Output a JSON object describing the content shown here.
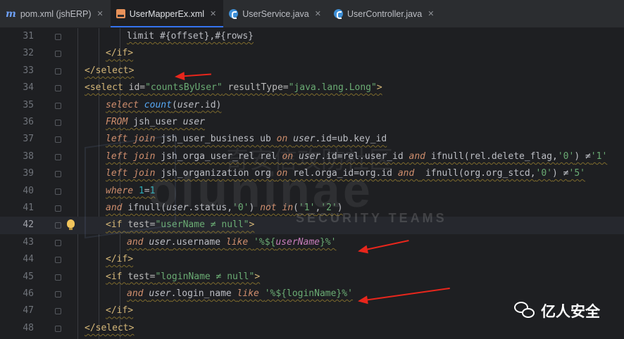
{
  "tabs": [
    {
      "label": "pom.xml (jshERP)",
      "icon": "maven-icon",
      "active": false
    },
    {
      "label": "UserMapperEx.xml",
      "icon": "xml-file-icon",
      "active": true
    },
    {
      "label": "UserService.java",
      "icon": "java-class-icon",
      "active": false
    },
    {
      "label": "UserController.java",
      "icon": "java-class-icon",
      "active": false
    }
  ],
  "editor": {
    "current_line": "42",
    "lines": [
      {
        "n": "31",
        "indent": 3,
        "tokens": [
          [
            "p",
            "limit #{offset},#{rows}"
          ]
        ]
      },
      {
        "n": "32",
        "indent": 2,
        "tokens": [
          [
            "t",
            "</if>"
          ]
        ]
      },
      {
        "n": "33",
        "indent": 1,
        "tokens": [
          [
            "t",
            "</select>"
          ]
        ]
      },
      {
        "n": "34",
        "indent": 1,
        "tokens": [
          [
            "t",
            "<select "
          ],
          [
            "a",
            "id="
          ],
          [
            "v",
            "\"countsByUser\""
          ],
          [
            "p",
            " "
          ],
          [
            "a",
            "resultType="
          ],
          [
            "v",
            "\"java.lang.Long\""
          ],
          [
            "t",
            ">"
          ]
        ]
      },
      {
        "n": "35",
        "indent": 2,
        "tokens": [
          [
            "kw",
            "select "
          ],
          [
            "fn",
            "count"
          ],
          [
            "p",
            "("
          ],
          [
            "it",
            "user"
          ],
          [
            "p",
            ".id)"
          ]
        ]
      },
      {
        "n": "36",
        "indent": 2,
        "tokens": [
          [
            "kw",
            "FROM"
          ],
          [
            "p",
            " jsh_user "
          ],
          [
            "it",
            "user"
          ]
        ]
      },
      {
        "n": "37",
        "indent": 2,
        "tokens": [
          [
            "kw",
            "left join"
          ],
          [
            "p",
            " jsh_user_business ub "
          ],
          [
            "kw",
            "on "
          ],
          [
            "it",
            "user"
          ],
          [
            "p",
            ".id=ub.key_id"
          ]
        ]
      },
      {
        "n": "38",
        "indent": 2,
        "tokens": [
          [
            "kw",
            "left join"
          ],
          [
            "p",
            " jsh_orga_user_rel rel "
          ],
          [
            "kw",
            "on "
          ],
          [
            "it",
            "user"
          ],
          [
            "p",
            ".id=rel.user_id "
          ],
          [
            "kw",
            "and "
          ],
          [
            "p",
            "ifnull(rel.delete_flag,"
          ],
          [
            "v",
            "'0'"
          ],
          [
            "p",
            ") ≠"
          ],
          [
            "v",
            "'1'"
          ]
        ]
      },
      {
        "n": "39",
        "indent": 2,
        "tokens": [
          [
            "kw",
            "left join"
          ],
          [
            "p",
            " jsh_organization org "
          ],
          [
            "kw",
            "on "
          ],
          [
            "p",
            "rel.orga_id=org.id "
          ],
          [
            "kw",
            "and "
          ],
          [
            "p",
            " ifnull(org.org_stcd,"
          ],
          [
            "v",
            "'0'"
          ],
          [
            "p",
            ") ≠"
          ],
          [
            "v",
            "'5'"
          ]
        ]
      },
      {
        "n": "40",
        "indent": 2,
        "tokens": [
          [
            "kw",
            "where "
          ],
          [
            "num",
            "1"
          ],
          [
            "p",
            "="
          ],
          [
            "num",
            "1"
          ]
        ]
      },
      {
        "n": "41",
        "indent": 2,
        "tokens": [
          [
            "kw",
            "and "
          ],
          [
            "p",
            "ifnull("
          ],
          [
            "it",
            "user"
          ],
          [
            "p",
            ".status,"
          ],
          [
            "v",
            "'0'"
          ],
          [
            "p",
            ") "
          ],
          [
            "kw",
            "not in"
          ],
          [
            "p",
            "("
          ],
          [
            "v",
            "'1'"
          ],
          [
            "p",
            ","
          ],
          [
            "v",
            "'2'"
          ],
          [
            "p",
            ")"
          ]
        ]
      },
      {
        "n": "42",
        "indent": 2,
        "tokens": [
          [
            "t",
            "<if "
          ],
          [
            "a",
            "test="
          ],
          [
            "v",
            "\"userName ≠ null\""
          ],
          [
            "t",
            ">"
          ]
        ]
      },
      {
        "n": "43",
        "indent": 3,
        "tokens": [
          [
            "kw",
            "and "
          ],
          [
            "it",
            "user"
          ],
          [
            "p",
            ".username "
          ],
          [
            "kw",
            "like "
          ],
          [
            "v",
            "'%${"
          ],
          [
            "var",
            "userName"
          ],
          [
            "v",
            "}%'"
          ]
        ]
      },
      {
        "n": "44",
        "indent": 2,
        "tokens": [
          [
            "t",
            "</if>"
          ]
        ]
      },
      {
        "n": "45",
        "indent": 2,
        "tokens": [
          [
            "t",
            "<if "
          ],
          [
            "a",
            "test="
          ],
          [
            "v",
            "\"loginName ≠ null\""
          ],
          [
            "t",
            ">"
          ]
        ]
      },
      {
        "n": "46",
        "indent": 3,
        "tokens": [
          [
            "kw",
            "and "
          ],
          [
            "it",
            "user"
          ],
          [
            "p",
            ".login_name "
          ],
          [
            "kw",
            "like "
          ],
          [
            "v",
            "'%${loginName}%'"
          ]
        ]
      },
      {
        "n": "47",
        "indent": 2,
        "tokens": [
          [
            "t",
            "</if>"
          ]
        ]
      },
      {
        "n": "48",
        "indent": 1,
        "tokens": [
          [
            "t",
            "</select>"
          ]
        ]
      }
    ]
  },
  "colors": {
    "annotation_arrow": "#e8261c",
    "editor_bg": "#1e1f22",
    "active_tab_underline": "#3574f0"
  },
  "watermark": {
    "chinese": "奇安信攻防社区",
    "latin": "oluninae",
    "subtitle": "SECURITY TEAMS"
  },
  "branding": {
    "text": "亿人安全",
    "icon": "wechat-icon"
  }
}
